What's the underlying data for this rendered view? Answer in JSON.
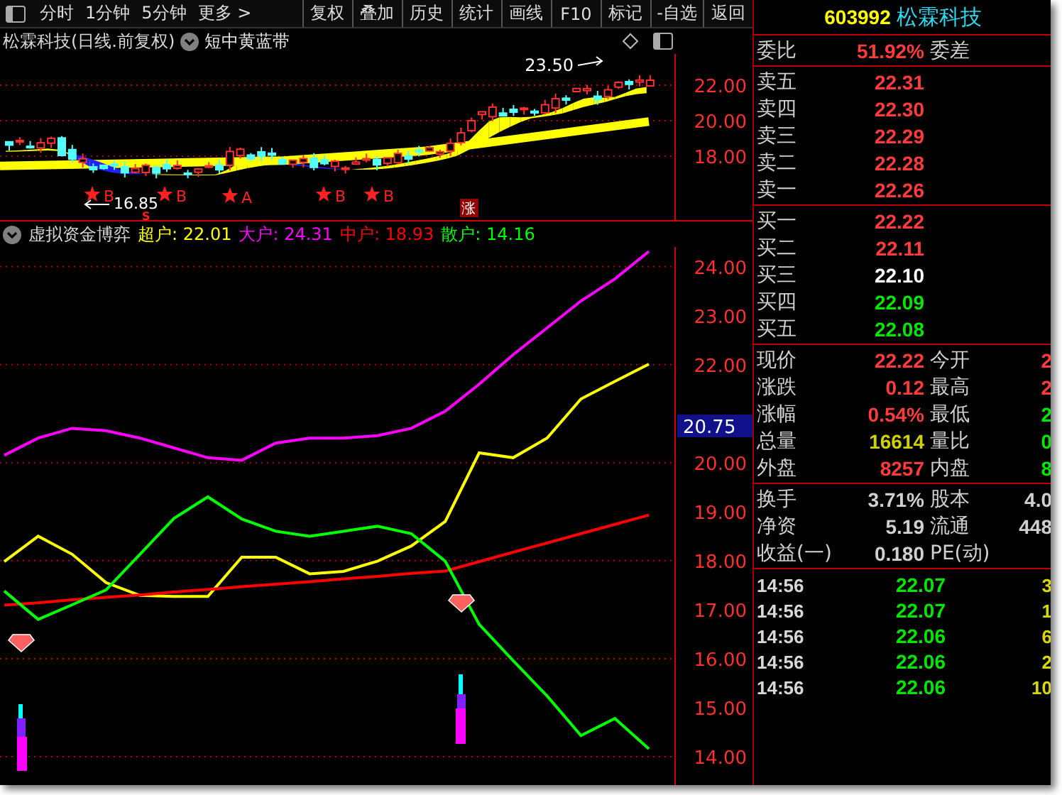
{
  "toolbar": {
    "tabs": [
      "分时",
      "1分钟",
      "5分钟"
    ],
    "more": "更多 >",
    "buttons": [
      "复权",
      "叠加",
      "历史",
      "统计",
      "画线",
      "F10",
      "标记",
      "-自选",
      "返回"
    ]
  },
  "upper_chart": {
    "title": "松霖科技(日线.前复权)",
    "indicator": "短中黄蓝带",
    "yticks": [
      "22.00",
      "20.00",
      "18.00"
    ],
    "annotations": [
      {
        "kind": "high",
        "text": "23.50"
      },
      {
        "kind": "low",
        "text": "16.85"
      },
      {
        "kind": "star",
        "text": "B"
      },
      {
        "kind": "star",
        "text": "B"
      },
      {
        "kind": "star",
        "text": "A"
      },
      {
        "kind": "star",
        "text": "B"
      },
      {
        "kind": "star",
        "text": "B"
      },
      {
        "kind": "sell",
        "text": "S"
      },
      {
        "kind": "tag",
        "text": "涨"
      }
    ]
  },
  "lower_chart": {
    "title": "虚拟资金博弈",
    "legend_values": [
      ": 22.01",
      ": 24.31",
      ": 18.93",
      ": 14.16"
    ],
    "price_tag": "20.75",
    "chart_data": {
      "type": "line",
      "grid": true,
      "ylim": [
        13.42,
        24.4
      ],
      "yticks": [
        {
          "value": 14,
          "label": "14.00"
        },
        {
          "value": 15,
          "label": "15.00"
        },
        {
          "value": 16,
          "label": "16.00"
        },
        {
          "value": 17,
          "label": "17.00"
        },
        {
          "value": 18,
          "label": "18.00"
        },
        {
          "value": 19,
          "label": "19.00"
        },
        {
          "value": 20,
          "label": "20.00"
        },
        {
          "value": 22,
          "label": "22.00"
        },
        {
          "value": 23,
          "label": "23.00"
        },
        {
          "value": 24,
          "label": "24.00"
        }
      ],
      "series": [
        {
          "name": "超户",
          "color": "#ffff00",
          "values": [
            17.98,
            18.5,
            18.13,
            17.55,
            17.29,
            17.27,
            17.27,
            18.07,
            18.07,
            17.73,
            17.78,
            17.99,
            18.3,
            18.8,
            20.2,
            20.1,
            20.5,
            21.3,
            21.66,
            22.01
          ]
        },
        {
          "name": "大户",
          "color": "#ff00ff",
          "values": [
            20.15,
            20.5,
            20.7,
            20.65,
            20.5,
            20.3,
            20.1,
            20.05,
            20.4,
            20.5,
            20.5,
            20.55,
            20.7,
            21.05,
            21.6,
            22.2,
            22.75,
            23.3,
            23.75,
            24.31
          ]
        },
        {
          "name": "中户",
          "color": "#ff0000",
          "values": [
            17.09,
            17.14,
            17.2,
            17.25,
            17.3,
            17.36,
            17.41,
            17.47,
            17.52,
            17.57,
            17.63,
            17.68,
            17.74,
            17.79,
            17.98,
            18.17,
            18.36,
            18.55,
            18.74,
            18.93
          ]
        },
        {
          "name": "散户",
          "color": "#00ff00",
          "values": [
            17.38,
            16.8,
            17.1,
            17.4,
            18.13,
            18.86,
            19.3,
            18.85,
            18.6,
            18.5,
            18.6,
            18.7,
            18.55,
            17.99,
            16.7,
            15.96,
            15.24,
            14.43,
            14.78,
            14.16
          ]
        }
      ]
    }
  },
  "quote": {
    "code": "603992",
    "name": "松霖科技",
    "ratio": {
      "label": "委比",
      "value": "51.92%",
      "label2": "委差"
    },
    "asks": [
      {
        "label": "卖五",
        "price": "22.31",
        "color": "#ff3c3c"
      },
      {
        "label": "卖四",
        "price": "22.30",
        "color": "#ff3c3c"
      },
      {
        "label": "卖三",
        "price": "22.29",
        "color": "#ff3c3c"
      },
      {
        "label": "卖二",
        "price": "22.28",
        "color": "#ff3c3c"
      },
      {
        "label": "卖一",
        "price": "22.26",
        "color": "#ff3c3c"
      }
    ],
    "bids": [
      {
        "label": "买一",
        "price": "22.22",
        "color": "#ff3c3c"
      },
      {
        "label": "买二",
        "price": "22.11",
        "color": "#ff3c3c"
      },
      {
        "label": "买三",
        "price": "22.10",
        "color": "#ffffff"
      },
      {
        "label": "买四",
        "price": "22.09",
        "color": "#00e600"
      },
      {
        "label": "买五",
        "price": "22.08",
        "color": "#00e600"
      }
    ],
    "stats": [
      {
        "left": {
          "label": "现价",
          "value": "22.22",
          "color": "#ff3c3c"
        },
        "right": {
          "label": "今开",
          "value": "2",
          "color": "#ff3c3c"
        }
      },
      {
        "left": {
          "label": "涨跌",
          "value": "0.12",
          "color": "#ff3c3c"
        },
        "right": {
          "label": "最高",
          "value": "2",
          "color": "#ff3c3c"
        }
      },
      {
        "left": {
          "label": "涨幅",
          "value": "0.54%",
          "color": "#ff3c3c"
        },
        "right": {
          "label": "最低",
          "value": "2",
          "color": "#00e600"
        }
      },
      {
        "left": {
          "label": "总量",
          "value": "16614",
          "color": "#d0d000"
        },
        "right": {
          "label": "量比",
          "value": "0",
          "color": "#00e600"
        }
      },
      {
        "left": {
          "label": "外盘",
          "value": "8257",
          "color": "#ff3c3c"
        },
        "right": {
          "label": "内盘",
          "value": "8",
          "color": "#00e600"
        }
      }
    ],
    "stats2": [
      {
        "label": "换手",
        "value": "3.71%",
        "label2": "股本",
        "value2": "4.0"
      },
      {
        "label": "净资",
        "value": "5.19",
        "label2": "流通",
        "value2": "448"
      },
      {
        "label": "收益(一)",
        "value": "0.180",
        "label2": "PE(动)"
      }
    ],
    "trades": [
      {
        "time": "14:56",
        "price": "22.07",
        "volume": "3"
      },
      {
        "time": "14:56",
        "price": "22.07",
        "volume": "1"
      },
      {
        "time": "14:56",
        "price": "22.06",
        "volume": "6"
      },
      {
        "time": "14:56",
        "price": "22.06",
        "volume": "2"
      },
      {
        "time": "14:56",
        "price": "22.06",
        "volume": "10"
      }
    ]
  }
}
